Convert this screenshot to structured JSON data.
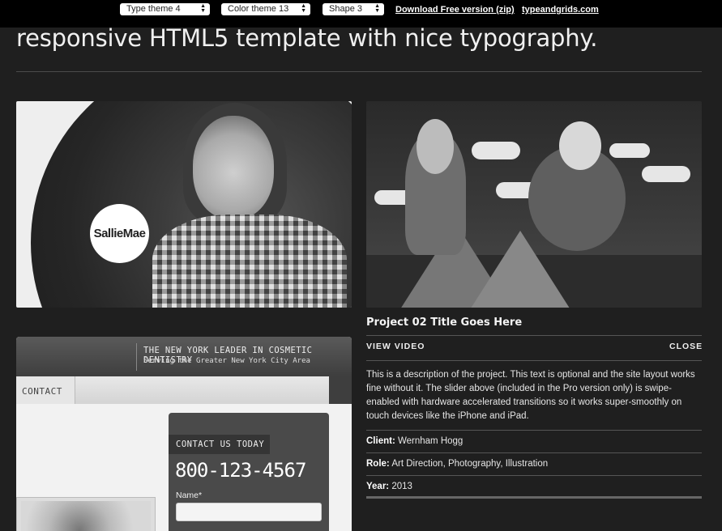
{
  "toolbar": {
    "type_theme": "Type theme 4",
    "color_theme": "Color theme 13",
    "shape": "Shape 3",
    "download_link": "Download Free version (zip)",
    "site_link": "typeandgrids.com"
  },
  "headline": "responsive HTML5 template with nice typography.",
  "portfolio_items": [
    {
      "logo_text": "SallieMae"
    },
    {
      "image": "illustration"
    }
  ],
  "dentistry": {
    "tagline": "THE NEW YORK LEADER IN COSMETIC DENTISTRY",
    "subtagline": "Serving the Greater New York City Area",
    "nav_contact": "CONTACT",
    "panel_title": "CONTACT US TODAY",
    "phone": "800-123-4567",
    "name_label": "Name*"
  },
  "project": {
    "title": "Project 02 Title Goes Here",
    "view_video": "VIEW VIDEO",
    "close": "CLOSE",
    "description": "This is a description of the project. This text is optional and the site layout works fine without it. The slider above (included in the Pro version only) is swipe-enabled with hardware accelerated transitions so it works super-smoothly on touch devices like the iPhone and iPad.",
    "client_label": "Client:",
    "client": "Wernham Hogg",
    "role_label": "Role:",
    "role": "Art Direction, Photography, Illustration",
    "year_label": "Year:",
    "year": "2013"
  }
}
